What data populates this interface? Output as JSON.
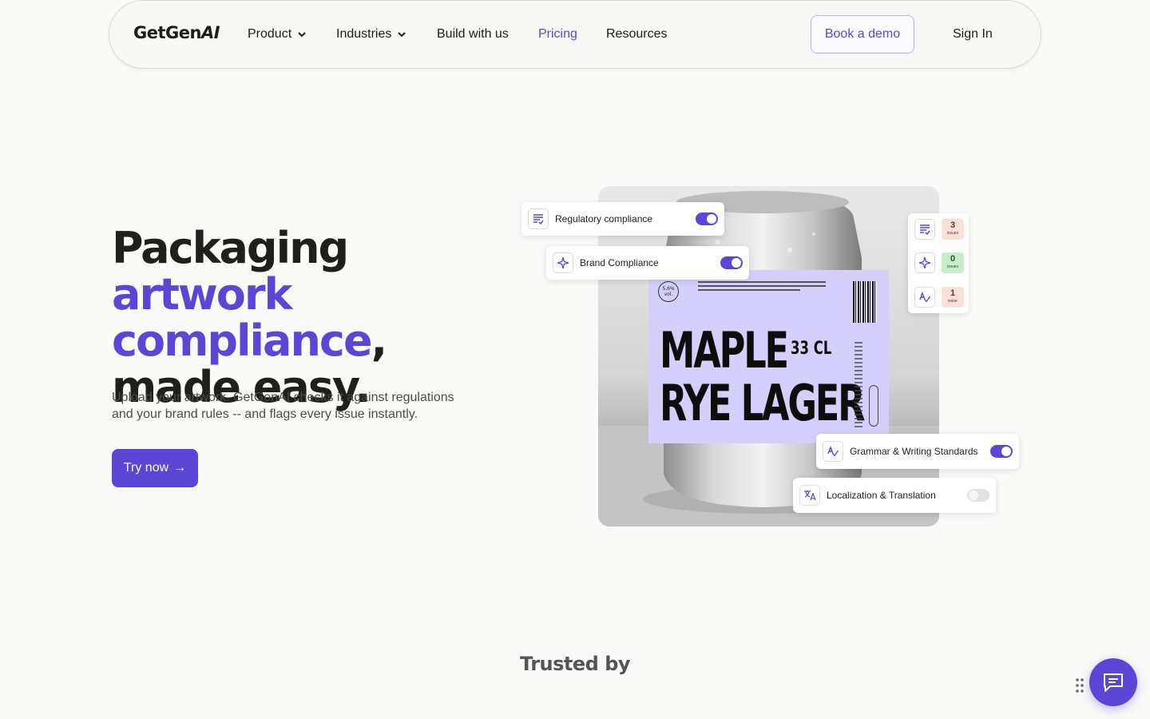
{
  "nav": {
    "logo_main": "GetGen",
    "logo_accent": "AI",
    "items": [
      {
        "label": "Product",
        "dropdown": true
      },
      {
        "label": "Industries",
        "dropdown": true
      },
      {
        "label": "Build with us",
        "dropdown": false
      },
      {
        "label": "Pricing",
        "dropdown": false,
        "active": true
      },
      {
        "label": "Resources",
        "dropdown": false
      }
    ],
    "demo_label": "Book a demo",
    "signin_label": "Sign In"
  },
  "hero": {
    "title_part1": "Packaging ",
    "title_highlight": "artwork compliance",
    "title_comma": ",",
    "title_part2": "made easy.",
    "subtitle": "Upload your artwork. GetGenAI checks it against regulations and your brand rules -- and flags every issue instantly.",
    "cta_label": "Try now",
    "cta_arrow": "→"
  },
  "artwork": {
    "label_line1": "MAPLE",
    "label_line2": "RYE LAGER",
    "volume": "33 CL",
    "abv": "5,6% vol."
  },
  "checks": [
    {
      "label": "Regulatory compliance",
      "icon": "list-check-icon",
      "enabled": true
    },
    {
      "label": "Brand Compliance",
      "icon": "sparkle-icon",
      "enabled": true
    },
    {
      "label": "Grammar & Writing Standards",
      "icon": "spellcheck-icon",
      "enabled": true
    },
    {
      "label": "Localization & Translation",
      "icon": "translate-icon",
      "enabled": false
    }
  ],
  "issues": [
    {
      "count": "3",
      "unit": "issues",
      "icon": "list-check-icon",
      "status": "warning"
    },
    {
      "count": "0",
      "unit": "issues",
      "icon": "sparkle-icon",
      "status": "ok"
    },
    {
      "count": "1",
      "unit": "issue",
      "icon": "spellcheck-icon",
      "status": "warning"
    }
  ],
  "trusted_title": "Trusted by",
  "colors": {
    "accent": "#5b46d6",
    "background": "#fafaf8",
    "label_bg": "#d4d0fb"
  }
}
